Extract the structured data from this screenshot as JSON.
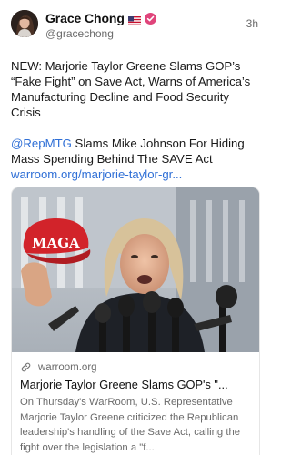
{
  "author": {
    "name": "Grace Chong",
    "handle": "@gracechong",
    "flag_icon": "us-flag-icon",
    "verified_icon": "verified-badge-icon",
    "verified_color": "#e0457b"
  },
  "post": {
    "time": "3h",
    "text": "NEW: Marjorie Taylor Greene Slams GOP’s “Fake Fight” on Save Act, Warns of America’s Manufacturing Decline and Food Security Crisis",
    "mention": "@RepMTG",
    "mention_rest": " Slams Mike Johnson For Hiding Mass Spending Behind The SAVE Act",
    "link": "warroom.org/marjorie-taylor-gr..."
  },
  "card": {
    "link_icon": "link-icon",
    "domain": "warroom.org",
    "title": "Marjorie Taylor Greene Slams GOP's \"...",
    "description": "On Thursday's WarRoom, U.S. Representative Marjorie Taylor Greene criticized the Republican leadership's handling of the Save Act, calling the fight over the legislation a \"f...",
    "image_hat_text": "MAGA"
  },
  "colors": {
    "link": "#2f6fd6",
    "muted": "#6b6b6b"
  }
}
